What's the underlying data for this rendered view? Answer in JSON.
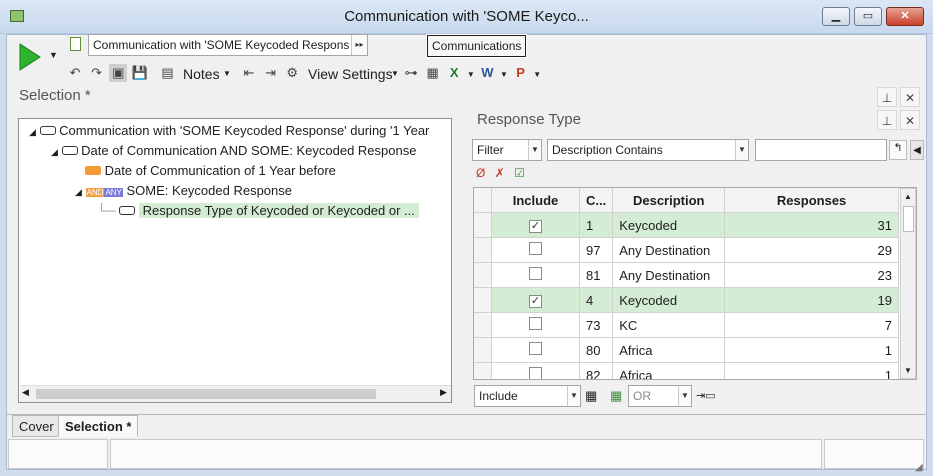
{
  "window": {
    "title": "Communication with 'SOME Keyco...",
    "minimize": "▁",
    "maximize": "▭",
    "close": "✕"
  },
  "toolbar": {
    "selection_name": "Communication with 'SOME Keycoded Respons",
    "tooltip": "Communications",
    "notes_label": "Notes",
    "view_settings_label": "View Settings"
  },
  "selection_panel": {
    "title": "Selection *",
    "tree": [
      {
        "label": "Communication with 'SOME Keycoded Response' during '1 Year"
      },
      {
        "label": "Date of Communication AND SOME: Keycoded Response"
      },
      {
        "label": "Date of Communication of 1 Year before"
      },
      {
        "label": "SOME: Keycoded Response",
        "and_badge": "AND",
        "any_badge": "ANY"
      },
      {
        "label": "Response Type of Keycoded or Keycoded or ..."
      }
    ]
  },
  "response_panel": {
    "title": "Response Type",
    "filter_label": "Filter",
    "filter_mode": "Description Contains",
    "filter_value": "",
    "columns": [
      "Include",
      "C...",
      "Description",
      "Responses"
    ],
    "rows": [
      {
        "include": true,
        "code": "1",
        "description": "Keycoded",
        "responses": "31"
      },
      {
        "include": false,
        "code": "97",
        "description": "Any Destination",
        "responses": "29"
      },
      {
        "include": false,
        "code": "81",
        "description": "Any Destination",
        "responses": "23"
      },
      {
        "include": true,
        "code": "4",
        "description": "Keycoded",
        "responses": "19"
      },
      {
        "include": false,
        "code": "73",
        "description": "KC",
        "responses": "7"
      },
      {
        "include": false,
        "code": "80",
        "description": "Africa",
        "responses": "1"
      },
      {
        "include": false,
        "code": "82",
        "description": "Africa",
        "responses": "1"
      }
    ],
    "bottom_mode": "Include",
    "bottom_operator": "OR"
  },
  "tabs": [
    {
      "label": "Cover",
      "active": false
    },
    {
      "label": "Selection *",
      "active": true
    }
  ],
  "colors": {
    "selected_row": "#d3ecd3",
    "run_button": "#2db32d",
    "date_node": "#f59a3a"
  }
}
